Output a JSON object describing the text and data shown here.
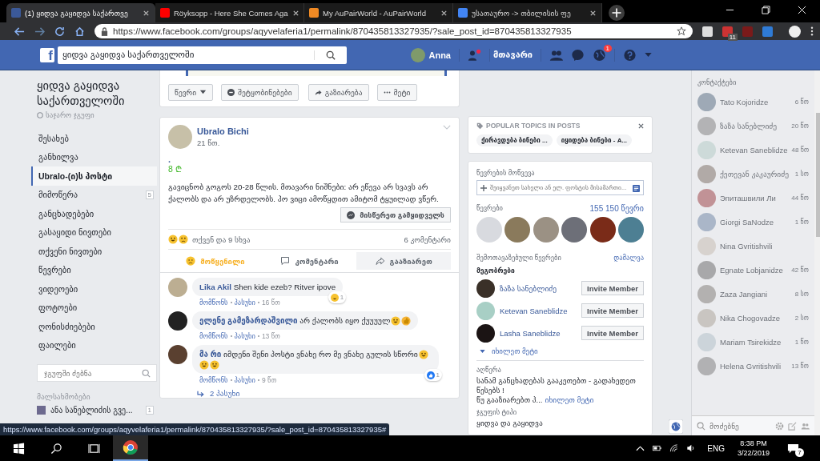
{
  "browser": {
    "tabs": [
      {
        "title": "(1) ყიდვა გაყიდვა საქართვე",
        "kind": "facebook",
        "selected": true
      },
      {
        "title": "Röyksopp - Here She Comes Aga",
        "kind": "youtube",
        "selected": false
      },
      {
        "title": "My AuPairWorld - AuPairWorld",
        "kind": "aupair",
        "selected": false
      },
      {
        "title": "უსათაურო -> თბილისის ფე",
        "kind": "doc",
        "selected": false
      }
    ],
    "url": "https://www.facebook.com/groups/aqyvelaferia1/permalink/870435813327935/?sale_post_id=870435813327935",
    "extension_badge": "11"
  },
  "topbar": {
    "logo": "f",
    "search_value": "ყიდვა გაყიდვა საქართველოში",
    "profile_name": "Anna",
    "home": "მთავარი",
    "notification_count": "1"
  },
  "sidebar": {
    "group_name": "ყიდვა გაყიდვა საქართველოში",
    "privacy": "საჯარო ჯგუფი",
    "items": [
      {
        "label": "შესახებ",
        "selected": false
      },
      {
        "label": "განხილვა",
        "selected": false
      },
      {
        "label": "Ubralo-(ი)ს პოსტი",
        "selected": true
      },
      {
        "label": "მიმოწერა",
        "selected": false,
        "count": "5"
      },
      {
        "label": "განცხადებები",
        "selected": false
      },
      {
        "label": "გასაყიდი ნივთები",
        "selected": false
      },
      {
        "label": "თქვენი ნივთები",
        "selected": false
      },
      {
        "label": "წევრები",
        "selected": false
      },
      {
        "label": "ვიდეოები",
        "selected": false
      },
      {
        "label": "ფოტოები",
        "selected": false
      },
      {
        "label": "ღონისძიებები",
        "selected": false
      },
      {
        "label": "ფაილები",
        "selected": false
      }
    ],
    "search_placeholder": "ჯგუფში ძებნა",
    "shortcuts_heading": "მალსახმობები",
    "shortcuts": [
      {
        "label": "ანა სანებლიძის გვე...",
        "count": "1"
      }
    ]
  },
  "group_actions": [
    {
      "label": "წევრი",
      "kind": "dropdown"
    },
    {
      "label": "შეტყობინებები",
      "kind": "notify"
    },
    {
      "label": "გაზიარება",
      "kind": "share"
    },
    {
      "label": "მეტი",
      "kind": "more"
    }
  ],
  "post": {
    "author": "Ubralo Bichi",
    "time": "21 წთ.",
    "title": ".",
    "price": "8 ₾",
    "text": "გავიცნობ გოგოს 20-28 წლის. მთავარი ნიშნები: არ ეწევა არ სვავს არ ქალობს და არ უზრდელობს. ჰო ვიცი ამოწყდით ამიტომ ტყუილად ვწერ.",
    "message_button": "მისწერეთ გამყიდველს",
    "reactions": [
      {
        "kind": "laugh"
      },
      {
        "kind": "sad"
      }
    ],
    "reactions_text": "თქვენ და 9 სხვა",
    "comments_count": "6 კომენტარი",
    "actions": [
      {
        "label": "მოწყენილი",
        "kind": "react",
        "selected": true
      },
      {
        "label": "კომენტარი",
        "kind": "comment",
        "selected": false
      },
      {
        "label": "გააზიარეთ",
        "kind": "share",
        "selected": false
      }
    ],
    "comments": [
      {
        "name": "Lika Akil",
        "text": "Shen kide ezeb? Ritver ipove",
        "reaction": {
          "kind": "laugh",
          "count": "1"
        },
        "like": "მომწონს",
        "reply": "პასუხი",
        "time": "16 წთ"
      },
      {
        "name": "ელენე გამეზარდაშვილი",
        "text": "არ ქალობს იყო ქუუუულ",
        "emojis": [
          {
            "kind": "laugh"
          },
          {
            "kind": "thumb"
          }
        ],
        "like": "მომწონს",
        "reply": "პასუხი",
        "time": "13 წთ"
      },
      {
        "name": "მა რი",
        "text": "იმდენი შენი პოსტი ვნახე რო მე ვნახე გულის სწორი",
        "emojis": [
          {
            "kind": "rofl"
          },
          {
            "kind": "rofl"
          },
          {
            "kind": "rofl"
          }
        ],
        "reaction": {
          "kind": "like",
          "count": "1"
        },
        "like": "მომწონს",
        "reply": "პასუხი",
        "time": "9 წთ"
      }
    ],
    "replies": "2 პასუხი"
  },
  "topics": {
    "heading": "POPULAR TOPICS IN POSTS",
    "chips": [
      "ქირავდება ბინები ...",
      "იყიდება ბინები - A..."
    ]
  },
  "members": {
    "invite_heading": "წევრების მოწვევა",
    "invite_placeholder": "შეიყვანეთ სახელი ან ელ. ფოსტის მისამართი...",
    "members_heading": "წევრები",
    "members_count": "155 150 წევრი",
    "suggested_heading": "შემოთავაზებული წევრები",
    "hide": "დამალვა",
    "friends_heading": "მეგობრები",
    "friends": [
      {
        "name": "ზაზა სანებლიძე",
        "button": "Invite Member"
      },
      {
        "name": "Ketevan Saneblidze",
        "button": "Invite Member"
      },
      {
        "name": "Lasha Saneblidze",
        "button": "Invite Member"
      }
    ],
    "see_more": "იხილეთ მეტი",
    "description_heading": "აღწერა",
    "description": "სანამ განცხადებას გააკეთებთ - გადახედეთ წესებს !",
    "description_more": "წუ გააზიარებთ პ...",
    "description_link": "იხილეთ მეტი",
    "type_heading": "ჯგუფის ტიპი",
    "type": "ყიდვა და გაყიდვა"
  },
  "chat": {
    "heading": "კონტაქტები",
    "contacts": [
      {
        "name": "Tato Kojoridze",
        "time": "6 წთ"
      },
      {
        "name": "ზაზა სანებლიძე",
        "time": "20 წთ"
      },
      {
        "name": "Ketevan Saneblidze",
        "time": "48 წთ"
      },
      {
        "name": "ქეთევან კაკაურიძე",
        "time": "1 სთ"
      },
      {
        "name": "Эпиташвили Ли",
        "time": "44 წთ"
      },
      {
        "name": "Giorgi SaNodze",
        "time": "1 წთ"
      },
      {
        "name": "Nina Gvritishvili"
      },
      {
        "name": "Egnate Lobjanidze",
        "time": "42 წთ"
      },
      {
        "name": "Zaza Jangiani",
        "time": "8 სთ"
      },
      {
        "name": "Nika Chogovadze",
        "time": "2 სთ"
      },
      {
        "name": "Mariam Tsirekidze",
        "time": "1 წთ"
      },
      {
        "name": "Helena Gvritishvili",
        "time": "13 წთ"
      }
    ],
    "search_placeholder": "მოძებნე"
  },
  "status_url": "https://www.facebook.com/groups/aqyvelaferia1/permalink/870435813327935/?sale_post_id=870435813327935#",
  "taskbar": {
    "language": "ENG",
    "time": "8:38 PM",
    "date": "3/22/2019",
    "notifications": "7"
  }
}
